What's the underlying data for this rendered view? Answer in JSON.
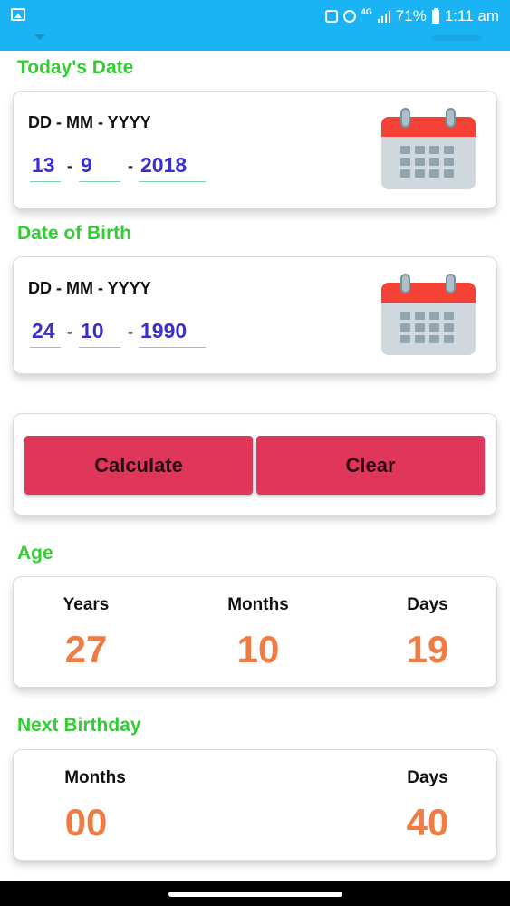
{
  "status_bar": {
    "network": "4G",
    "battery": "71%",
    "time": "1:11 am",
    "icons": [
      "image-icon",
      "notification-icon",
      "alarm-icon",
      "signal-icon",
      "battery-icon"
    ]
  },
  "todays_date": {
    "title": "Today's Date",
    "format_label": "DD - MM - YYYY",
    "day": "13",
    "month": "9",
    "year": "2018",
    "icon": "calendar-icon"
  },
  "date_of_birth": {
    "title": "Date of Birth",
    "format_label": "DD - MM - YYYY",
    "day": "24",
    "month": "10",
    "year": "1990",
    "icon": "calendar-icon"
  },
  "date_separator": "-",
  "actions": {
    "calculate_label": "Calculate",
    "clear_label": "Clear"
  },
  "age": {
    "title": "Age",
    "years_label": "Years",
    "months_label": "Months",
    "days_label": "Days",
    "years": "27",
    "months": "10",
    "days": "19"
  },
  "next_birthday": {
    "title": "Next Birthday",
    "months_label": "Months",
    "days_label": "Days",
    "months": "00",
    "days": "40"
  },
  "colors": {
    "status_bar": "#1ab4f5",
    "section_title": "#33cc33",
    "date_value": "#3a2fc9",
    "result_value": "#f07b43",
    "button": "#e0365a",
    "calendar_header": "#f44336"
  }
}
